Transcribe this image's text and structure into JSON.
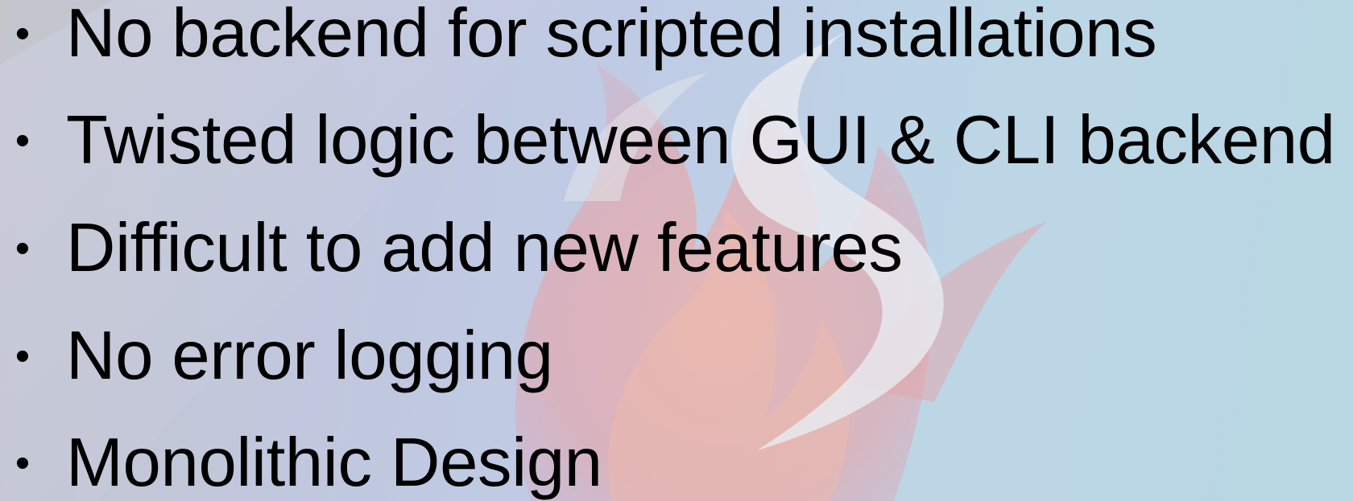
{
  "slide": {
    "bullet_symbol": "•",
    "bullets": [
      "No backend for scripted installations",
      "Twisted logic between GUI & CLI backend",
      "Difficult to add new features",
      "No error logging",
      "Monolithic Design"
    ]
  },
  "colors": {
    "text": "#000000",
    "background_left": "#c4c6cc",
    "background_right": "#bad7e4",
    "logo_flame": "#e8a0a0",
    "logo_swirl": "#e6e8ec"
  }
}
